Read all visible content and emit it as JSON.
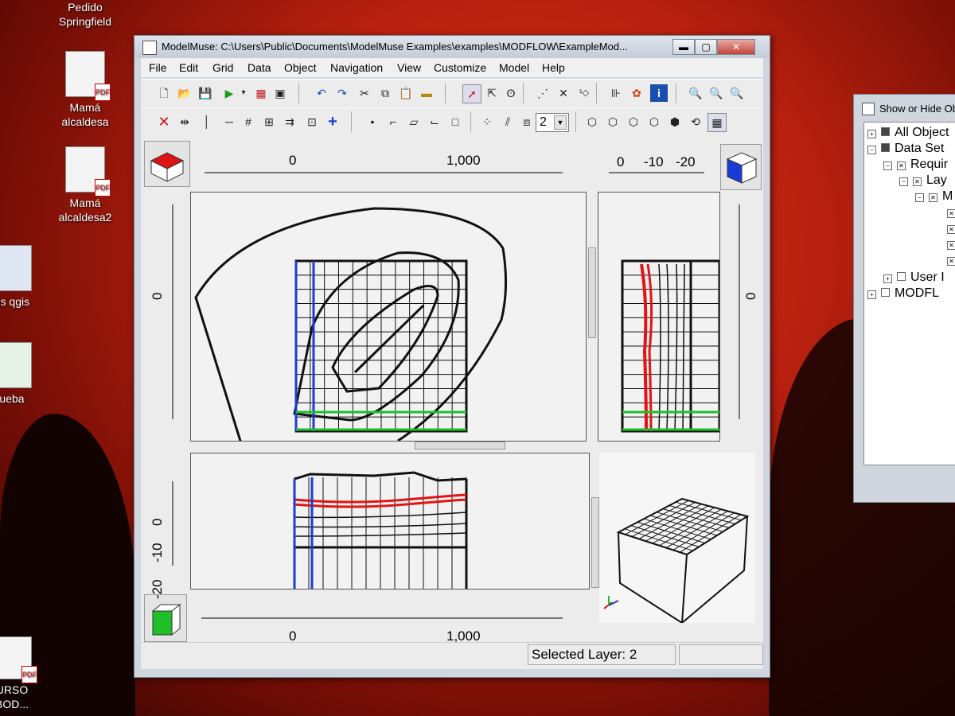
{
  "desktop": {
    "icons": [
      {
        "label_line1": "Pedido",
        "label_line2": "Springfield"
      },
      {
        "label_line1": "Mamá",
        "label_line2": "alcaldesa"
      },
      {
        "label_line1": "Mamá",
        "label_line2": "alcaldesa2"
      },
      {
        "label_line1": "os qgis",
        "label_line2": ""
      },
      {
        "label_line1": "ueba",
        "label_line2": ""
      },
      {
        "label_line1": "URSO",
        "label_line2": "BOD..."
      }
    ]
  },
  "window": {
    "title": "ModelMuse: C:\\Users\\Public\\Documents\\ModelMuse Examples\\examples\\MODFLOW\\ExampleMod...",
    "controls": {
      "minimize": "▬",
      "maximize": "▢",
      "close": "✕"
    }
  },
  "menu": [
    "File",
    "Edit",
    "Grid",
    "Data",
    "Object",
    "Navigation",
    "View",
    "Customize",
    "Model",
    "Help"
  ],
  "toolbar2": {
    "layer_select_value": "2"
  },
  "rulers": {
    "top_x_labels": [
      "0",
      "1,000"
    ],
    "top_right_labels": [
      "0",
      "-10",
      "-20"
    ],
    "left_y_label": "0",
    "right_y_label": "0",
    "front_z_labels": [
      "0",
      "-10",
      "-20"
    ],
    "bottom_x_labels": [
      "0",
      "1,000"
    ]
  },
  "status": {
    "selected_layer": "Selected Layer: 2"
  },
  "colors": {
    "highlight_red": "#e01414",
    "column_blue": "#1a3cd6",
    "row_green": "#1fbf2a",
    "contour_black": "#111111"
  },
  "side_window": {
    "title": "Show or Hide Ob",
    "tree": [
      {
        "label": "All Object",
        "checked": "partial"
      },
      {
        "label": "Data Set",
        "checked": "partial"
      },
      {
        "label": "Requir",
        "checked": "x"
      },
      {
        "label": "Lay",
        "checked": "x"
      },
      {
        "label": "M",
        "checked": "x"
      },
      {
        "label": "User I",
        "checked": "none"
      },
      {
        "label": "MODFL",
        "checked": "none"
      }
    ]
  }
}
